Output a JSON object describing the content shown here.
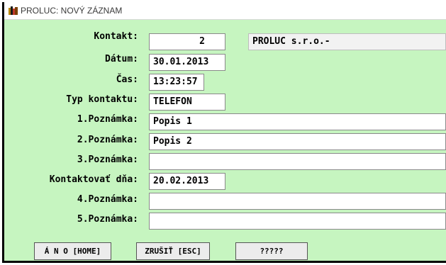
{
  "window": {
    "title": "PROLUC: NOVÝ ZÁZNAM",
    "icon": "books-icon"
  },
  "form": {
    "kontakt": {
      "label": "Kontakt:",
      "value": "2",
      "company": "PROLUC s.r.o.-"
    },
    "datum": {
      "label": "Dátum:",
      "value": "30.01.2013"
    },
    "cas": {
      "label": "Čas:",
      "value": "13:23:57"
    },
    "typ": {
      "label": "Typ kontaktu:",
      "value": "TELEFON"
    },
    "poznamka1": {
      "label": "1.Poznámka:",
      "value": "Popis 1"
    },
    "poznamka2": {
      "label": "2.Poznámka:",
      "value": "Popis 2"
    },
    "poznamka3": {
      "label": "3.Poznámka:",
      "value": ""
    },
    "kontaktovat": {
      "label": "Kontaktovať dňa:",
      "value": "20.02.2013"
    },
    "poznamka4": {
      "label": "4.Poznámka:",
      "value": ""
    },
    "poznamka5": {
      "label": "5.Poznámka:",
      "value": ""
    }
  },
  "buttons": {
    "ano": "Á N O [HOME]",
    "zrusit": "ZRUŠIŤ [ESC]",
    "extra": "?????"
  },
  "colors": {
    "background": "#c6f5c0",
    "field": "#ffffff"
  }
}
